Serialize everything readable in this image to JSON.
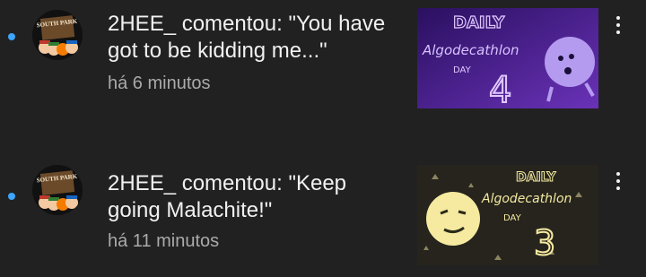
{
  "notifications": [
    {
      "message": "2HEE_ comentou: \"You have got to be kidding me...\"",
      "time": "há 6 minutos",
      "thumbnail": {
        "line1": "DAILY",
        "line2": "Algodecathlon",
        "line3": "DAY",
        "number": "4",
        "bg": "#3b1a78"
      },
      "avatar_text": "SOUTH PARK"
    },
    {
      "message": "2HEE_ comentou: \"Keep going Malachite!\"",
      "time": "há 11 minutos",
      "thumbnail": {
        "line1": "DAILY",
        "line2": "Algodecathlon",
        "line3": "DAY",
        "number": "3",
        "bg": "#26241d"
      },
      "avatar_text": "SOUTH PARK"
    }
  ],
  "colors": {
    "unread": "#3ea6ff",
    "background": "#212121"
  }
}
